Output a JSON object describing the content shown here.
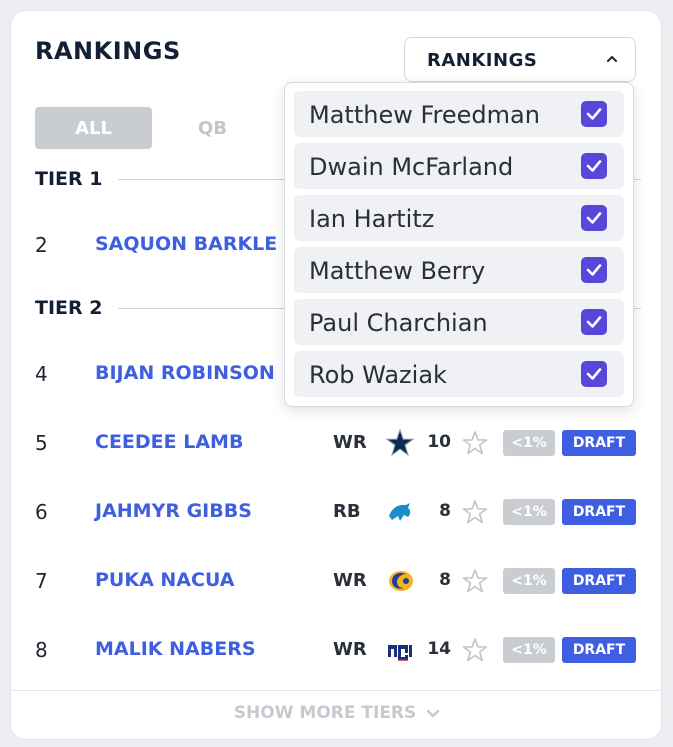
{
  "title": "RANKINGS",
  "ranking_select": {
    "label": "RANKINGS"
  },
  "position_tabs": [
    "ALL",
    "QB"
  ],
  "tiers": [
    {
      "name": "TIER 1"
    },
    {
      "name": "TIER 2"
    }
  ],
  "players": [
    {
      "rank": "2",
      "name": "SAQUON BARKLE",
      "team": ""
    },
    {
      "rank": "4",
      "name": "BIJAN ROBINSON",
      "team": ""
    },
    {
      "rank": "5",
      "name": "CEEDEE LAMB",
      "pos": "WR",
      "team": "cowboys-logo",
      "bye": "10",
      "pct": "<1%",
      "action": "DRAFT"
    },
    {
      "rank": "6",
      "name": "JAHMYR GIBBS",
      "pos": "RB",
      "team": "lions-logo",
      "bye": "8",
      "pct": "<1%",
      "action": "DRAFT"
    },
    {
      "rank": "7",
      "name": "PUKA NACUA",
      "pos": "WR",
      "team": "rams-logo",
      "bye": "8",
      "pct": "<1%",
      "action": "DRAFT"
    },
    {
      "rank": "8",
      "name": "MALIK NABERS",
      "pos": "WR",
      "team": "giants-logo",
      "bye": "14",
      "pct": "<1%",
      "action": "DRAFT"
    }
  ],
  "footer": {
    "show_more": "SHOW MORE TIERS"
  },
  "dropdown": {
    "items": [
      {
        "name": "Matthew Freedman",
        "checked": true
      },
      {
        "name": "Dwain McFarland",
        "checked": true
      },
      {
        "name": "Ian Hartitz",
        "checked": true
      },
      {
        "name": "Matthew Berry",
        "checked": true
      },
      {
        "name": "Paul Charchian",
        "checked": true
      },
      {
        "name": "Rob Waziak",
        "checked": true
      }
    ]
  },
  "colors": {
    "accent": "#3f5fe3",
    "checkbox": "#5847d9",
    "player_link": "#3d5fe0",
    "muted_badge": "#c9ccd1"
  },
  "icons": [
    "chevron-up-icon",
    "chevron-down-icon",
    "star-icon",
    "checkbox-checked-icon"
  ]
}
